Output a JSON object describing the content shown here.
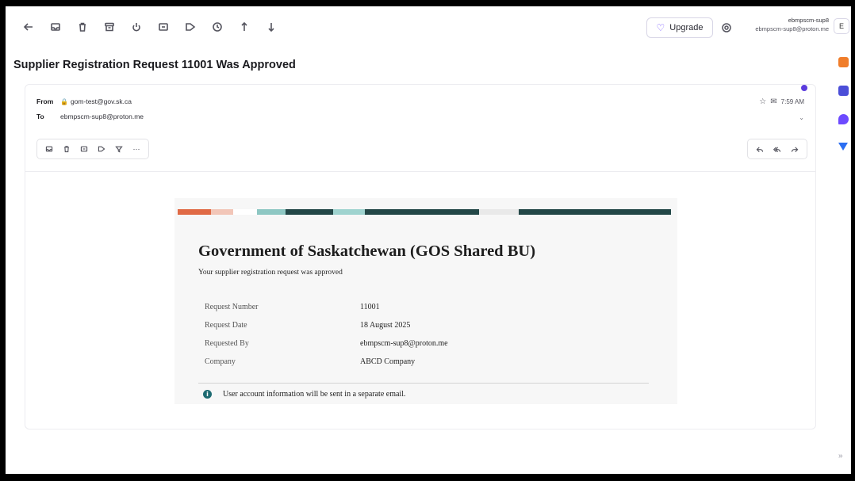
{
  "toolbar": {
    "icons": [
      "back-arrow-icon",
      "move-to-inbox-icon",
      "trash-icon",
      "archive-icon",
      "spam-icon",
      "folder-icon",
      "label-icon",
      "snooze-icon",
      "previous-message-icon",
      "next-message-icon"
    ],
    "upgrade_label": "Upgrade",
    "account_name": "ebmpscm-sup8",
    "account_email": "ebmpscm-sup8@proton.me",
    "avatar_initial": "E"
  },
  "message": {
    "subject": "Supplier Registration Request 11001 Was Approved",
    "from_label": "From",
    "from_value": "gom-test@gov.sk.ca",
    "to_label": "To",
    "to_value": "ebmpscm-sup8@proton.me",
    "time": "7:59 AM"
  },
  "email": {
    "title": "Government of Saskatchewan (GOS Shared BU)",
    "subtitle": "Your supplier registration request was approved",
    "details": [
      {
        "label": "Request Number",
        "value": "11001"
      },
      {
        "label": "Request Date",
        "value": "18 August 2025"
      },
      {
        "label": "Requested By",
        "value": "ebmpscm-sup8@proton.me"
      },
      {
        "label": "Company",
        "value": "ABCD Company"
      }
    ],
    "info": "User account information will be sent in a separate email."
  },
  "colors": {
    "accent": "#6d4aff",
    "banner_dark": "#234747",
    "info_icon": "#1e6b72",
    "rail": [
      "#f07d2a",
      "#4b4ed8",
      "#6d4aff",
      "#2b6ef2"
    ]
  }
}
